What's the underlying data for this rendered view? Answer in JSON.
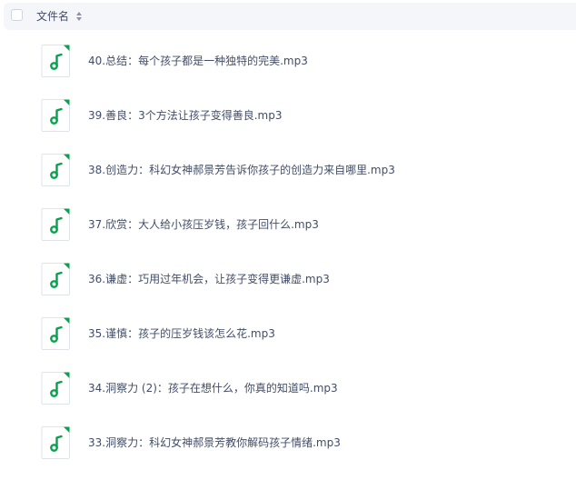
{
  "header": {
    "column_label": "文件名",
    "sort_icon": "sort-toggle-icon"
  },
  "file_icon": "music-note-icon",
  "accent_color": "#06a24b",
  "files": [
    {
      "name": "40.总结：每个孩子都是一种独特的完美.mp3"
    },
    {
      "name": "39.善良：3个方法让孩子变得善良.mp3"
    },
    {
      "name": "38.创造力：科幻女神郝景芳告诉你孩子的创造力来自哪里.mp3"
    },
    {
      "name": "37.欣赏：大人给小孩压岁钱，孩子回什么.mp3"
    },
    {
      "name": "36.谦虚：巧用过年机会，让孩子变得更谦虚.mp3"
    },
    {
      "name": "35.谨慎：孩子的压岁钱该怎么花.mp3"
    },
    {
      "name": "34.洞察力 (2)：孩子在想什么，你真的知道吗.mp3"
    },
    {
      "name": "33.洞察力：科幻女神郝景芳教你解码孩子情绪.mp3"
    }
  ]
}
